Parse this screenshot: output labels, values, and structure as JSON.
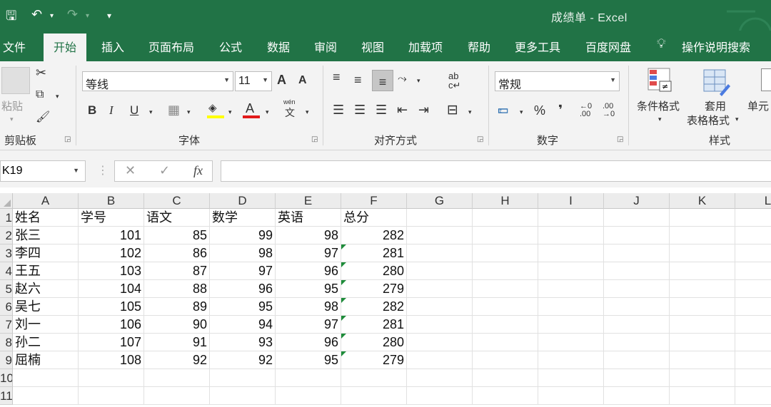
{
  "window": {
    "title": "成绩单  -  Excel"
  },
  "qat": {
    "save": "🖫",
    "undo": "↶",
    "redo": "↷",
    "customize": "▾"
  },
  "tabs": [
    "文件",
    "开始",
    "插入",
    "页面布局",
    "公式",
    "数据",
    "审阅",
    "视图",
    "加载项",
    "帮助",
    "更多工具",
    "百度网盘",
    "操作说明搜索"
  ],
  "ribbon": {
    "clipboard": {
      "paste": "粘贴",
      "label": "剪贴板"
    },
    "font": {
      "name": "等线",
      "size": "11",
      "grow": "A",
      "shrink": "A",
      "bold": "B",
      "italic": "I",
      "underline": "U",
      "wen": "wén",
      "wen_char": "文",
      "label": "字体"
    },
    "align": {
      "label": "对齐方式"
    },
    "number": {
      "format": "常规",
      "percent": "%",
      "comma": "❜",
      "inc": ".0",
      "dec": ".00",
      "label": "数字"
    },
    "styles": {
      "cond": "条件格式",
      "table1": "套用",
      "table2": "表格格式",
      "cell": "单元",
      "label": "样式"
    }
  },
  "formula": {
    "namebox": "K19",
    "cancel": "✕",
    "enter": "✓",
    "fx": "fx"
  },
  "columns": [
    "A",
    "B",
    "C",
    "D",
    "E",
    "F",
    "G",
    "H",
    "I",
    "J",
    "K",
    "L"
  ],
  "rows": [
    "1",
    "2",
    "3",
    "4",
    "5",
    "6",
    "7",
    "8",
    "9",
    "10",
    "11"
  ],
  "headers": [
    "姓名",
    "学号",
    "语文",
    "数学",
    "英语",
    "总分"
  ],
  "records": [
    {
      "name": "张三",
      "id": "101",
      "chinese": "85",
      "math": "99",
      "english": "98",
      "total": "282",
      "flag": false
    },
    {
      "name": "李四",
      "id": "102",
      "chinese": "86",
      "math": "98",
      "english": "97",
      "total": "281",
      "flag": true
    },
    {
      "name": "王五",
      "id": "103",
      "chinese": "87",
      "math": "97",
      "english": "96",
      "total": "280",
      "flag": true
    },
    {
      "name": "赵六",
      "id": "104",
      "chinese": "88",
      "math": "96",
      "english": "95",
      "total": "279",
      "flag": true
    },
    {
      "name": "吴七",
      "id": "105",
      "chinese": "89",
      "math": "95",
      "english": "98",
      "total": "282",
      "flag": true
    },
    {
      "name": "刘一",
      "id": "106",
      "chinese": "90",
      "math": "94",
      "english": "97",
      "total": "281",
      "flag": true
    },
    {
      "name": "孙二",
      "id": "107",
      "chinese": "91",
      "math": "93",
      "english": "96",
      "total": "280",
      "flag": true
    },
    {
      "name": "屈楠",
      "id": "108",
      "chinese": "92",
      "math": "92",
      "english": "95",
      "total": "279",
      "flag": true
    }
  ],
  "colors": {
    "accent": "#217346",
    "error_triangle": "#1e8c3a",
    "font_color": "#e21a1a",
    "highlight": "#ffff00"
  }
}
